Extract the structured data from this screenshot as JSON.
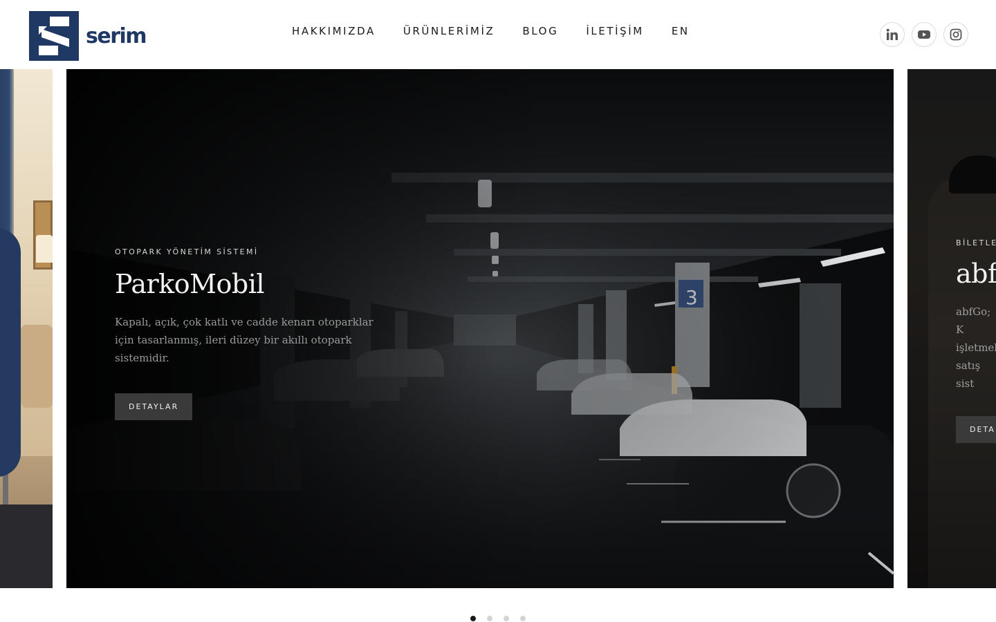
{
  "brand": {
    "name": "serim",
    "color": "#1f3864"
  },
  "nav": {
    "items": [
      {
        "label": "HAKKIMIZDA"
      },
      {
        "label": "ÜRÜNLERİMİZ"
      },
      {
        "label": "BLOG"
      },
      {
        "label": "İLETİŞİM"
      },
      {
        "label": "EN"
      }
    ]
  },
  "social": {
    "items": [
      {
        "icon": "linkedin-icon"
      },
      {
        "icon": "youtube-icon"
      },
      {
        "icon": "instagram-icon"
      }
    ]
  },
  "slides": {
    "main": {
      "eyebrow": "OTOPARK YÖNETİM SİSTEMİ",
      "title": "ParkoMobil",
      "description": "Kapalı, açık, çok katlı ve cadde kenarı otoparklar için tasarlanmış, ileri düzey bir akıllı otopark sistemidir.",
      "button": "DETAYLAR"
    },
    "next": {
      "eyebrow": "BİLETLE",
      "title": "abfG",
      "description": "abfGo; K işletmel satış sist",
      "button": "DETA"
    }
  },
  "pagination": {
    "count": 4,
    "active_index": 0
  }
}
